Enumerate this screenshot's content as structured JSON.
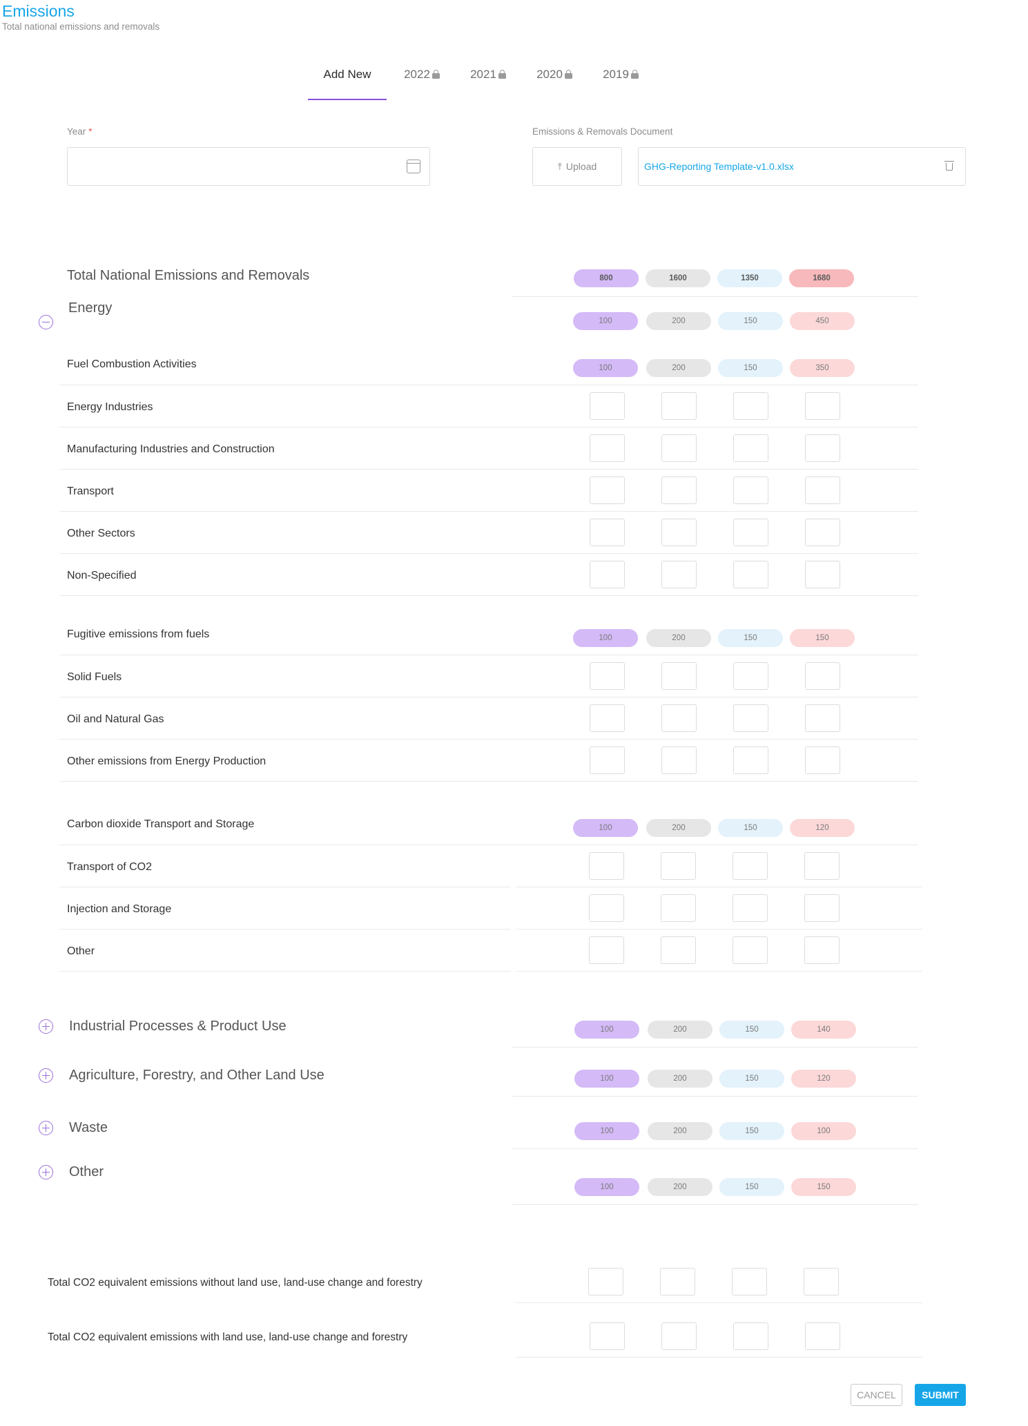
{
  "header": {
    "title": "Emissions",
    "subtitle": "Total national emissions and removals"
  },
  "tabs": [
    {
      "label": "Add New",
      "locked": false,
      "active": true
    },
    {
      "label": "2022",
      "locked": true,
      "active": false
    },
    {
      "label": "2021",
      "locked": true,
      "active": false
    },
    {
      "label": "2020",
      "locked": true,
      "active": false
    },
    {
      "label": "2019",
      "locked": true,
      "active": false
    }
  ],
  "form": {
    "year_label": "Year",
    "year_required": "*",
    "year_value": "",
    "document_label": "Emissions & Removals Document",
    "upload_label": "Upload",
    "file_name": "GHG-Reporting Template-v1.0.xlsx"
  },
  "colors": {
    "accent": "#16a6e8",
    "purple": "#d4baf7",
    "grey": "#e6e6e6",
    "blue": "#e3f2fb",
    "pink": "#fcd8d9"
  },
  "total": {
    "label": "Total National Emissions and Removals",
    "values": [
      "800",
      "1600",
      "1350",
      "1680"
    ]
  },
  "energy": {
    "label": "Energy",
    "values": [
      "100",
      "200",
      "150",
      "450"
    ],
    "expanded": true,
    "groups": [
      {
        "label": "Fuel Combustion Activities",
        "values": [
          "100",
          "200",
          "150",
          "350"
        ],
        "rows": [
          "Energy Industries",
          "Manufacturing Industries and Construction",
          "Transport",
          "Other Sectors",
          "Non-Specified"
        ]
      },
      {
        "label": "Fugitive emissions from fuels",
        "values": [
          "100",
          "200",
          "150",
          "150"
        ],
        "rows": [
          "Solid Fuels",
          "Oil and Natural Gas",
          "Other emissions from Energy Production"
        ]
      },
      {
        "label": "Carbon dioxide Transport and Storage",
        "values": [
          "100",
          "200",
          "150",
          "120"
        ],
        "rows": [
          "Transport of CO2",
          "Injection and Storage",
          "Other"
        ]
      }
    ]
  },
  "collapsed_sections": [
    {
      "label": "Industrial Processes & Product Use",
      "values": [
        "100",
        "200",
        "150",
        "140"
      ]
    },
    {
      "label": "Agriculture, Forestry, and Other Land Use",
      "values": [
        "100",
        "200",
        "150",
        "120"
      ]
    },
    {
      "label": "Waste",
      "values": [
        "100",
        "200",
        "150",
        "100"
      ]
    },
    {
      "label": "Other",
      "values": [
        "100",
        "200",
        "150",
        "150"
      ]
    }
  ],
  "totals": [
    {
      "label": "Total CO2 equivalent emissions without land use, land-use change and forestry"
    },
    {
      "label": "Total CO2 equivalent emissions with land use, land-use change and forestry"
    }
  ],
  "actions": {
    "cancel": "CANCEL",
    "submit": "SUBMIT"
  }
}
